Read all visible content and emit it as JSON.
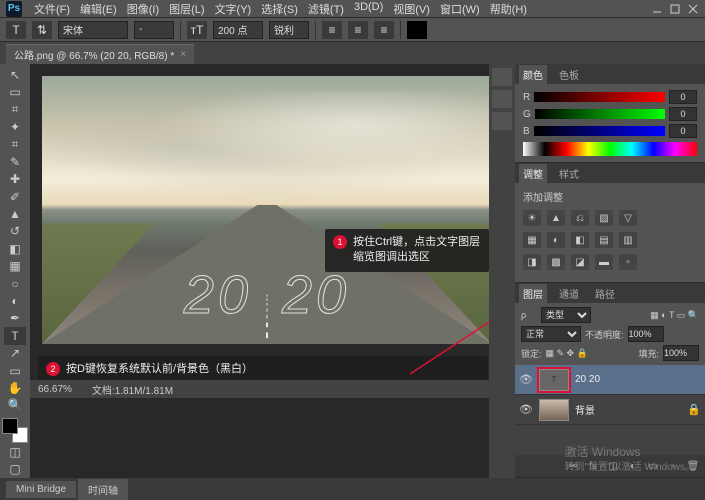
{
  "app": {
    "logo": "Ps"
  },
  "menu": [
    "文件(F)",
    "编辑(E)",
    "图像(I)",
    "图层(L)",
    "文字(Y)",
    "选择(S)",
    "滤镜(T)",
    "3D(D)",
    "视图(V)",
    "窗口(W)",
    "帮助(H)"
  ],
  "options": {
    "font": "宋体",
    "size": "200 点",
    "aa": "锐利"
  },
  "doc_tab": {
    "title": "公路.png @ 66.7% (20 20, RGB/8) *"
  },
  "canvas": {
    "text_left": "20",
    "text_right": "20"
  },
  "callouts": {
    "c1": {
      "num": "1",
      "text": "按住Ctrl键，点击文字图层缩览图调出选区"
    },
    "c2": {
      "num": "2",
      "text": "按D键恢复系统默认前/背景色（黑白）"
    }
  },
  "status": {
    "zoom": "66.67%",
    "doc": "文档:1.81M/1.81M"
  },
  "bottom_tabs": [
    "Mini Bridge",
    "时间轴"
  ],
  "color_panel": {
    "tab1": "颜色",
    "tab2": "色板",
    "r": "R",
    "g": "G",
    "b": "B",
    "rv": "0",
    "gv": "0",
    "bv": "0"
  },
  "adjust_panel": {
    "tab1": "调整",
    "tab2": "样式",
    "title": "添加调整"
  },
  "layers_panel": {
    "tabs": [
      "图层",
      "通道",
      "路径"
    ],
    "kind": "类型",
    "blend": "正常",
    "opacity_label": "不透明度:",
    "opacity": "100%",
    "lock_label": "锁定:",
    "fill_label": "填充:",
    "fill": "100%",
    "layers": [
      {
        "name": "20 20",
        "thumb": "T"
      },
      {
        "name": "背景",
        "thumb": ""
      }
    ]
  },
  "watermark": {
    "l1": "激活 Windows",
    "l2": "转到\"设置\"以激活 Windows。"
  }
}
